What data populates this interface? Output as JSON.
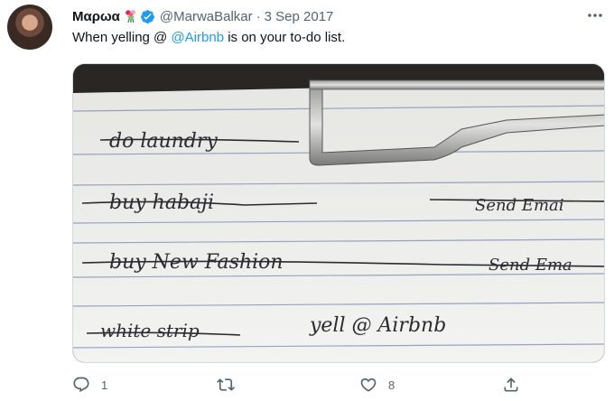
{
  "user": {
    "display_name": "Μαρωα",
    "handle": "@MarwaBalkar",
    "separator": "·",
    "date": "3 Sep 2017",
    "emoji_icon": "bouquet-icon",
    "verified_icon": "verified-badge-icon",
    "verified_color": "#1d9bf0"
  },
  "tweet": {
    "text_before": "When yelling @ ",
    "mention": "@Airbnb",
    "text_after": " is on your to-do list.",
    "mention_color": "#1d9bf0"
  },
  "media": {
    "kind": "photo",
    "handwriting": [
      "do laundry",
      "buy habaji",
      "Send Emai",
      "buy New Fashion",
      "Send Ema",
      "white strip",
      "yell @ Airbnb"
    ]
  },
  "actions": {
    "reply_icon": "reply-icon",
    "reply_count": "1",
    "retweet_icon": "retweet-icon",
    "retweet_count": "",
    "like_icon": "heart-icon",
    "like_count": "8",
    "share_icon": "share-icon"
  },
  "menu": {
    "more_icon": "more-horizontal-icon"
  }
}
